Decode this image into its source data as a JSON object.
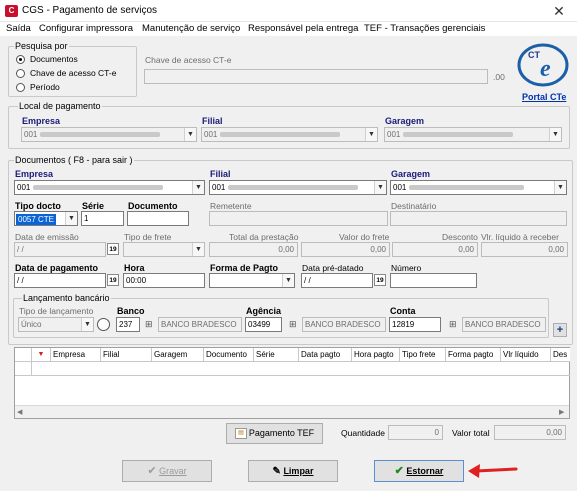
{
  "window": {
    "title": "CGS - Pagamento de serviços",
    "close_glyph": "✕"
  },
  "menu": [
    "Saída",
    "Configurar impressora",
    "Manutenção de serviço",
    "Responsável pela entrega",
    "TEF - Transações gerenciais"
  ],
  "pesquisa": {
    "legend": "Pesquisa por",
    "options": [
      "Documentos",
      "Chave de acesso CT-e",
      "Período"
    ],
    "selected": "Documentos"
  },
  "chave": {
    "label": "Chave de acesso CT-e",
    "suffix": ".00"
  },
  "portal": {
    "label": "Portal CTe",
    "logo": "CTe"
  },
  "local": {
    "legend": "Local de pagamento",
    "empresa_label": "Empresa",
    "empresa_value": "001",
    "filial_label": "Filial",
    "filial_value": "001",
    "garagem_label": "Garagem",
    "garagem_value": "001"
  },
  "docs": {
    "legend": "Documentos ( F8 - para sair )",
    "empresa_label": "Empresa",
    "empresa_value": "001",
    "filial_label": "Filial",
    "filial_value": "001",
    "garagem_label": "Garagem",
    "garagem_value": "001",
    "tipo_label": "Tipo docto",
    "tipo_value": "0057 CTE",
    "serie_label": "Série",
    "serie_value": "1",
    "documento_label": "Documento",
    "documento_value": "",
    "remetente_label": "Remetente",
    "destinatario_label": "Destinatário",
    "emissao_label": "Data de emissão",
    "emissao_value": "/ /",
    "frete_label": "Tipo de frete",
    "total_label": "Total da prestação",
    "total_value": "0,00",
    "valor_frete_label": "Valor do frete",
    "valor_frete_value": "0,00",
    "desconto_label": "Desconto",
    "desconto_value": "0,00",
    "liquido_label": "Vlr. líquido à receber",
    "liquido_value": "0,00",
    "pagamento_label": "Data de pagamento",
    "pagamento_value": "/ /",
    "hora_label": "Hora",
    "hora_value": "00:00",
    "forma_label": "Forma de Pagto",
    "pre_label": "Data pré-datado",
    "pre_value": "/ /",
    "numero_label": "Número",
    "cal_glyph": "19"
  },
  "bancario": {
    "legend": "Lançamento bancário",
    "tipo_label": "Tipo de lançamento",
    "tipo_value": "Único",
    "banco_label": "Banco",
    "banco_code": "237",
    "banco_name": "BANCO BRADESCO",
    "agencia_label": "Agência",
    "agencia_code": "03499",
    "agencia_name": "BANCO BRADESCO",
    "conta_label": "Conta",
    "conta_code": "12819",
    "conta_name": "BANCO BRADESCO",
    "add_glyph": "+",
    "bino_glyph": "⊞"
  },
  "grid": {
    "columns": [
      "Empresa",
      "Filial",
      "Garagem",
      "Documento",
      "Série",
      "Data pagto",
      "Hora pagto",
      "Tipo frete",
      "Forma pagto",
      "Vlr líquido",
      "Des"
    ]
  },
  "footer": {
    "tef_label": "Pagamento TEF",
    "quantidade_label": "Quantidade",
    "quantidade_value": "0",
    "total_label": "Valor total",
    "total_value": "0,00"
  },
  "buttons": {
    "gravar": "Gravar",
    "limpar": "Limpar",
    "estornar": "Estornar"
  },
  "colors": {
    "accent": "#1a1a7a",
    "arrow": "#e02020",
    "check": "#1a8a1a",
    "tipo_selected_bg": "#0a64d6"
  }
}
